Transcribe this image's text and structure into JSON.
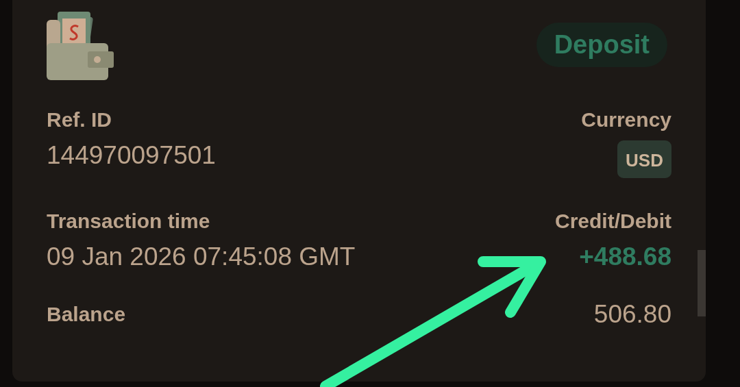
{
  "transaction": {
    "badge": "Deposit",
    "rows": [
      {
        "left": {
          "label": "Ref. ID",
          "value": "144970097501"
        },
        "right": {
          "label": "Currency",
          "value": "USD",
          "kind": "chip"
        }
      },
      {
        "left": {
          "label": "Transaction time",
          "value": "09 Jan 2026 07:45:08 GMT"
        },
        "right": {
          "label": "Credit/Debit",
          "value": "+488.68",
          "kind": "credit"
        }
      }
    ],
    "balance": {
      "label": "Balance",
      "value": "506.80"
    }
  }
}
